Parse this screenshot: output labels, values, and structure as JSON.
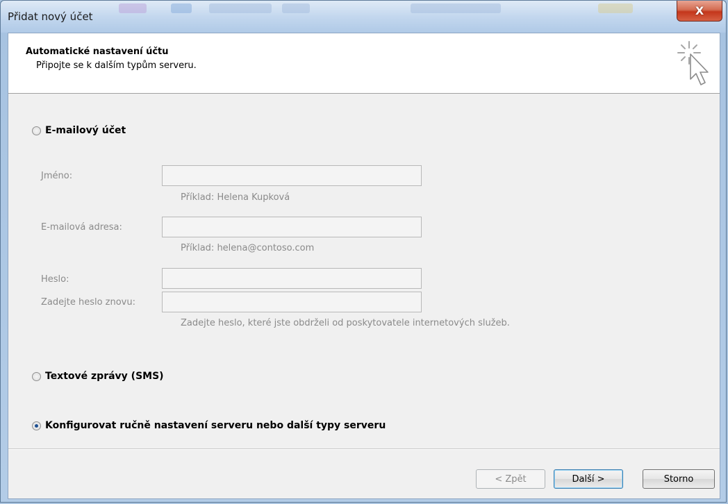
{
  "window": {
    "title": "Přidat nový účet",
    "close_label": "X"
  },
  "header": {
    "title": "Automatické nastavení účtu",
    "subtitle": "Připojte se k dalším typům serveru."
  },
  "options": {
    "email_account": {
      "label": "E-mailový účet",
      "selected": false
    },
    "sms": {
      "label": "Textové zprávy (SMS)",
      "selected": false
    },
    "manual": {
      "label": "Konfigurovat ručně nastavení serveru nebo další typy serveru",
      "selected": true
    }
  },
  "form": {
    "name": {
      "label": "Jméno:",
      "value": "",
      "hint": "Příklad: Helena Kupková"
    },
    "email": {
      "label": "E-mailová adresa:",
      "value": "",
      "hint": "Příklad: helena@contoso.com"
    },
    "password": {
      "label": "Heslo:",
      "value": ""
    },
    "password_repeat": {
      "label": "Zadejte heslo znovu:",
      "value": "",
      "hint": "Zadejte heslo, které jste obdrželi od poskytovatele internetových služeb."
    }
  },
  "buttons": {
    "back": "< Zpět",
    "next": "Další >",
    "cancel": "Storno"
  },
  "colors": {
    "accent": "#1d4f91",
    "close_button": "#c4361b",
    "disabled_text": "#8a8a8a"
  }
}
